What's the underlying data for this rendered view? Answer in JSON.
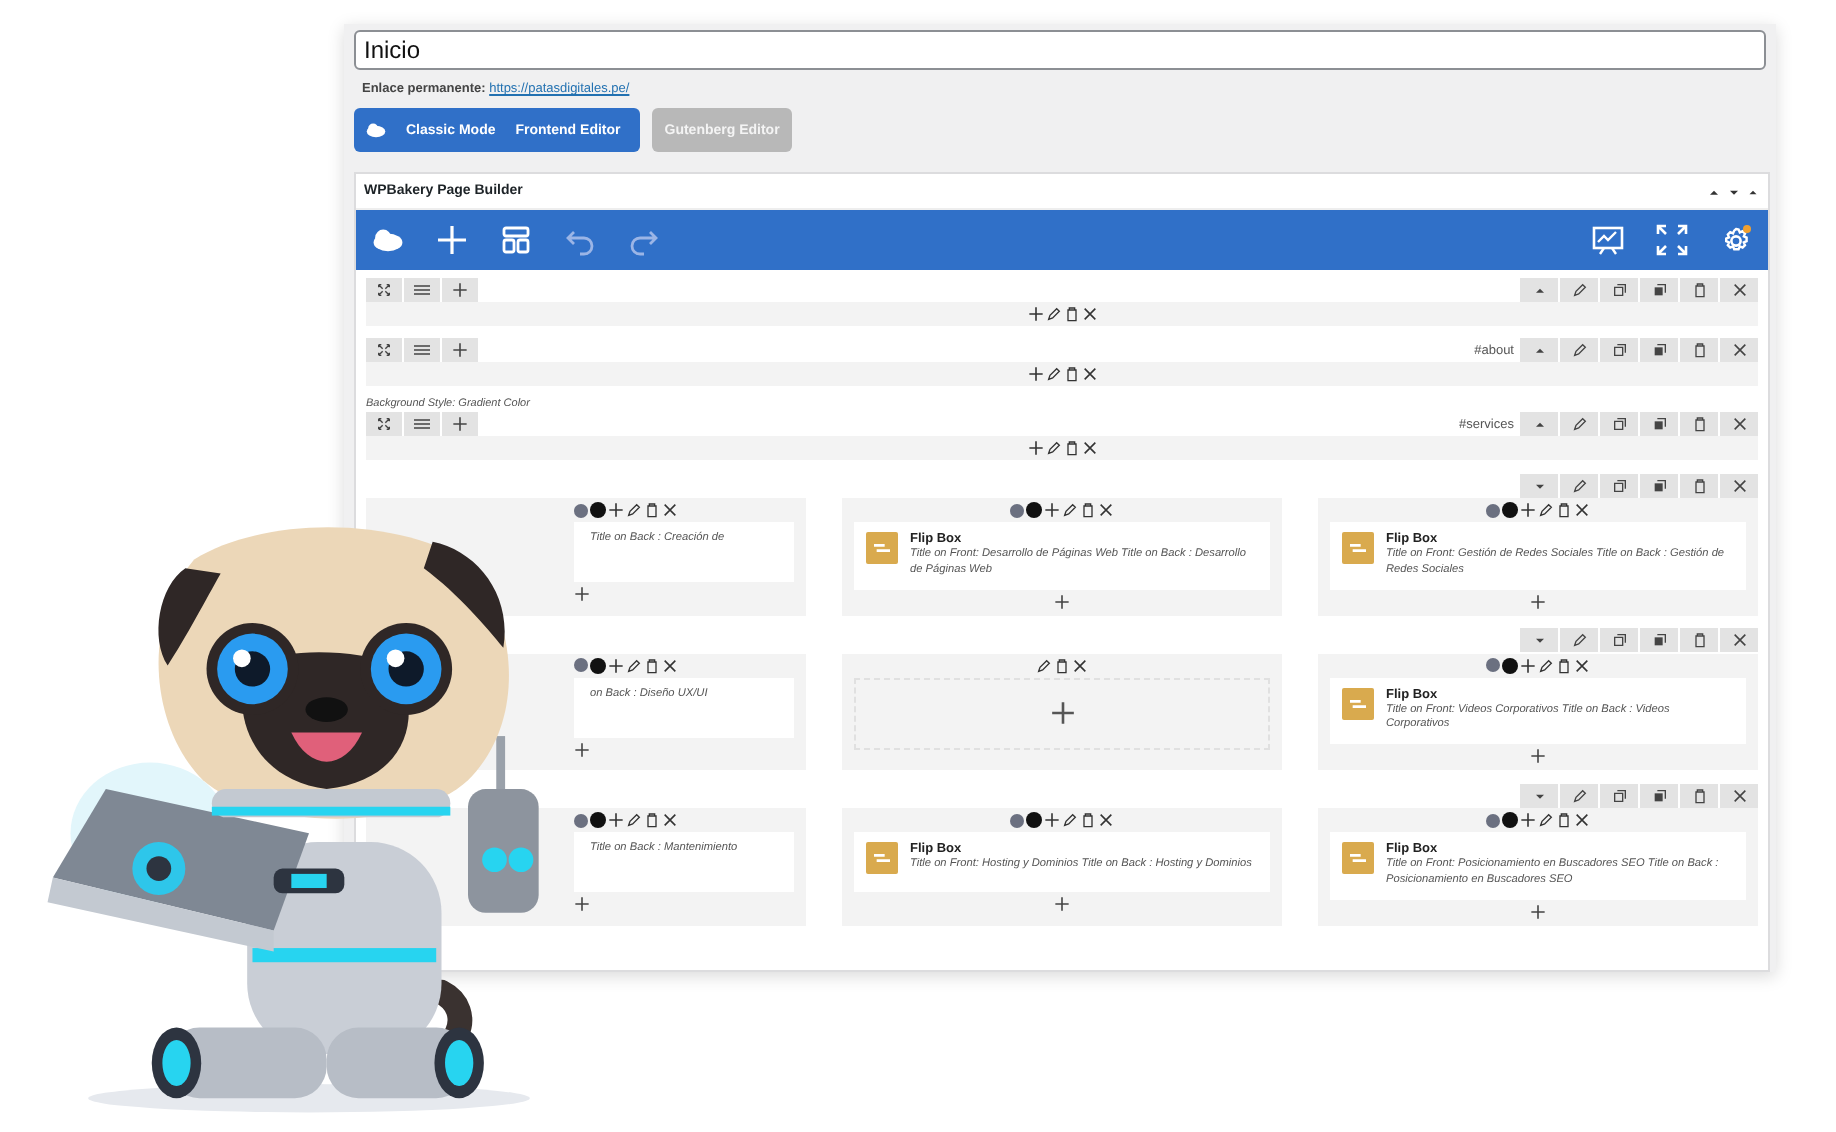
{
  "title_field": {
    "value": "Inicio"
  },
  "permalink": {
    "label": "Enlace permanente:",
    "url": "https://patasdigitales.pe/"
  },
  "mode_switch": {
    "active": true,
    "labels": [
      "Classic Mode",
      "Frontend Editor"
    ]
  },
  "gutenberg_button": {
    "label": "Gutenberg Editor",
    "disabled": true
  },
  "builder": {
    "title": "WPBakery Page Builder",
    "rows": [
      {
        "expanded": true,
        "columns": [
          {}
        ]
      },
      {
        "expanded": true,
        "anchor": "#about",
        "columns": [
          {}
        ]
      },
      {
        "expanded": true,
        "note": "Background Style: Gradient Color",
        "anchor": "#services",
        "columns": [
          {}
        ]
      },
      {
        "expanded": false,
        "columns": [
          {
            "element": {
              "description": "Title on Back : Creación de"
            }
          },
          {
            "element": {
              "title": "Flip Box",
              "description": "Title on Front: Desarrollo de Páginas Web  Title on Back : Desarrollo de Páginas Web"
            }
          },
          {
            "element": {
              "title": "Flip Box",
              "description": "Title on Front: Gestión de Redes Sociales  Title on Back : Gestión de Redes Sociales"
            }
          }
        ]
      },
      {
        "expanded": false,
        "columns": [
          {
            "element": {
              "description": "on Back : Diseño UX/UI"
            }
          },
          {},
          {
            "element": {
              "title": "Flip Box",
              "description": "Title on Front: Videos Corporativos  Title on Back : Videos Corporativos"
            }
          }
        ]
      },
      {
        "expanded": false,
        "columns": [
          {
            "element": {
              "description": "Title on Back : Mantenimiento"
            }
          },
          {
            "element": {
              "title": "Flip Box",
              "description": "Title on Front: Hosting y Dominios  Title on Back : Hosting y Dominios"
            }
          },
          {
            "element": {
              "title": "Flip Box",
              "description": "Title on Front: Posicionamiento en Buscadores SEO  Title on Back : Posicionamiento en Buscadores SEO"
            }
          }
        ]
      }
    ]
  }
}
